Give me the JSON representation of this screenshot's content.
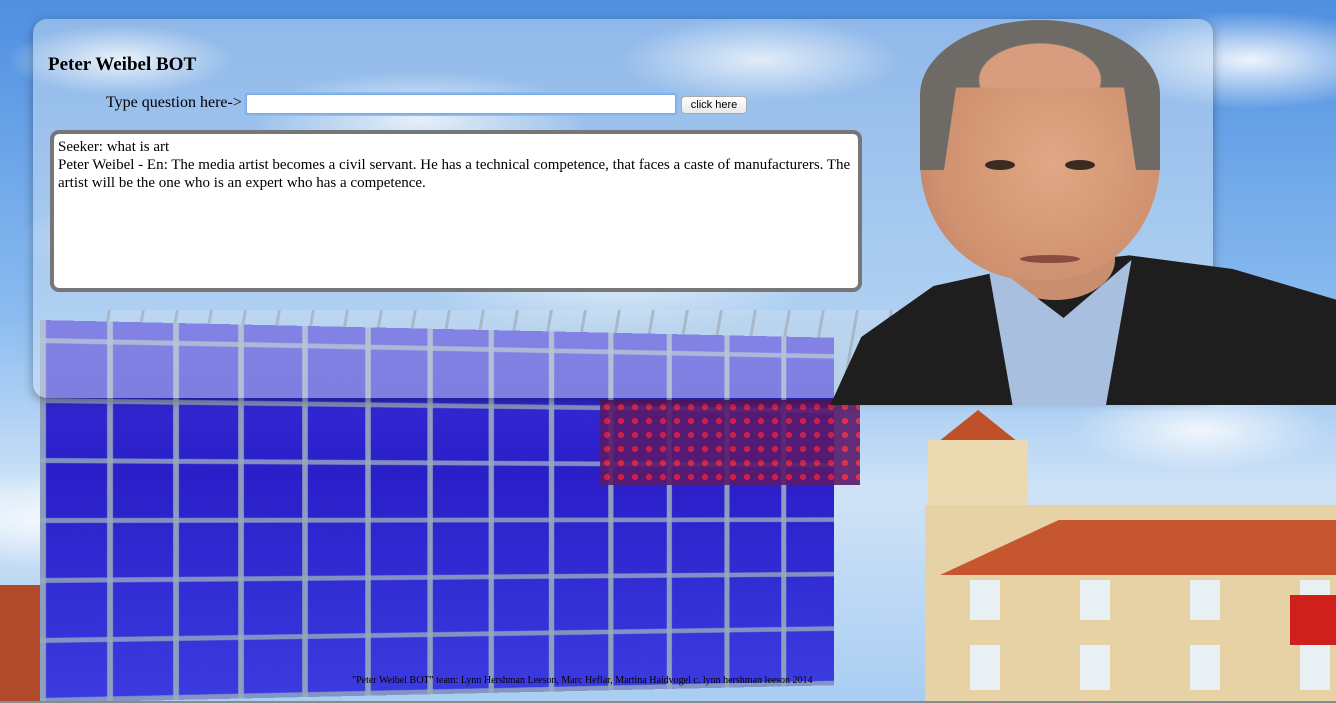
{
  "app": {
    "title": "Peter Weibel BOT"
  },
  "form": {
    "prompt_label": "Type question here->",
    "input_value": "",
    "submit_label": "click here"
  },
  "conversation": {
    "lines": [
      "Seeker: what is art",
      "Peter Weibel - En: The media artist becomes a civil servant. He has a technical competence, that faces a caste of manufacturers. The artist will be the one who is an expert who has a competence."
    ]
  },
  "footer": {
    "credits": "\"Peter Weibel BOT\" team: Lynn Hershman Leeson, Marc Heflar, Martina Haidvogel c. lynn hershman leeson 2014"
  },
  "colors": {
    "panel_border": "#777777",
    "input_focus": "#8ab8f0"
  }
}
